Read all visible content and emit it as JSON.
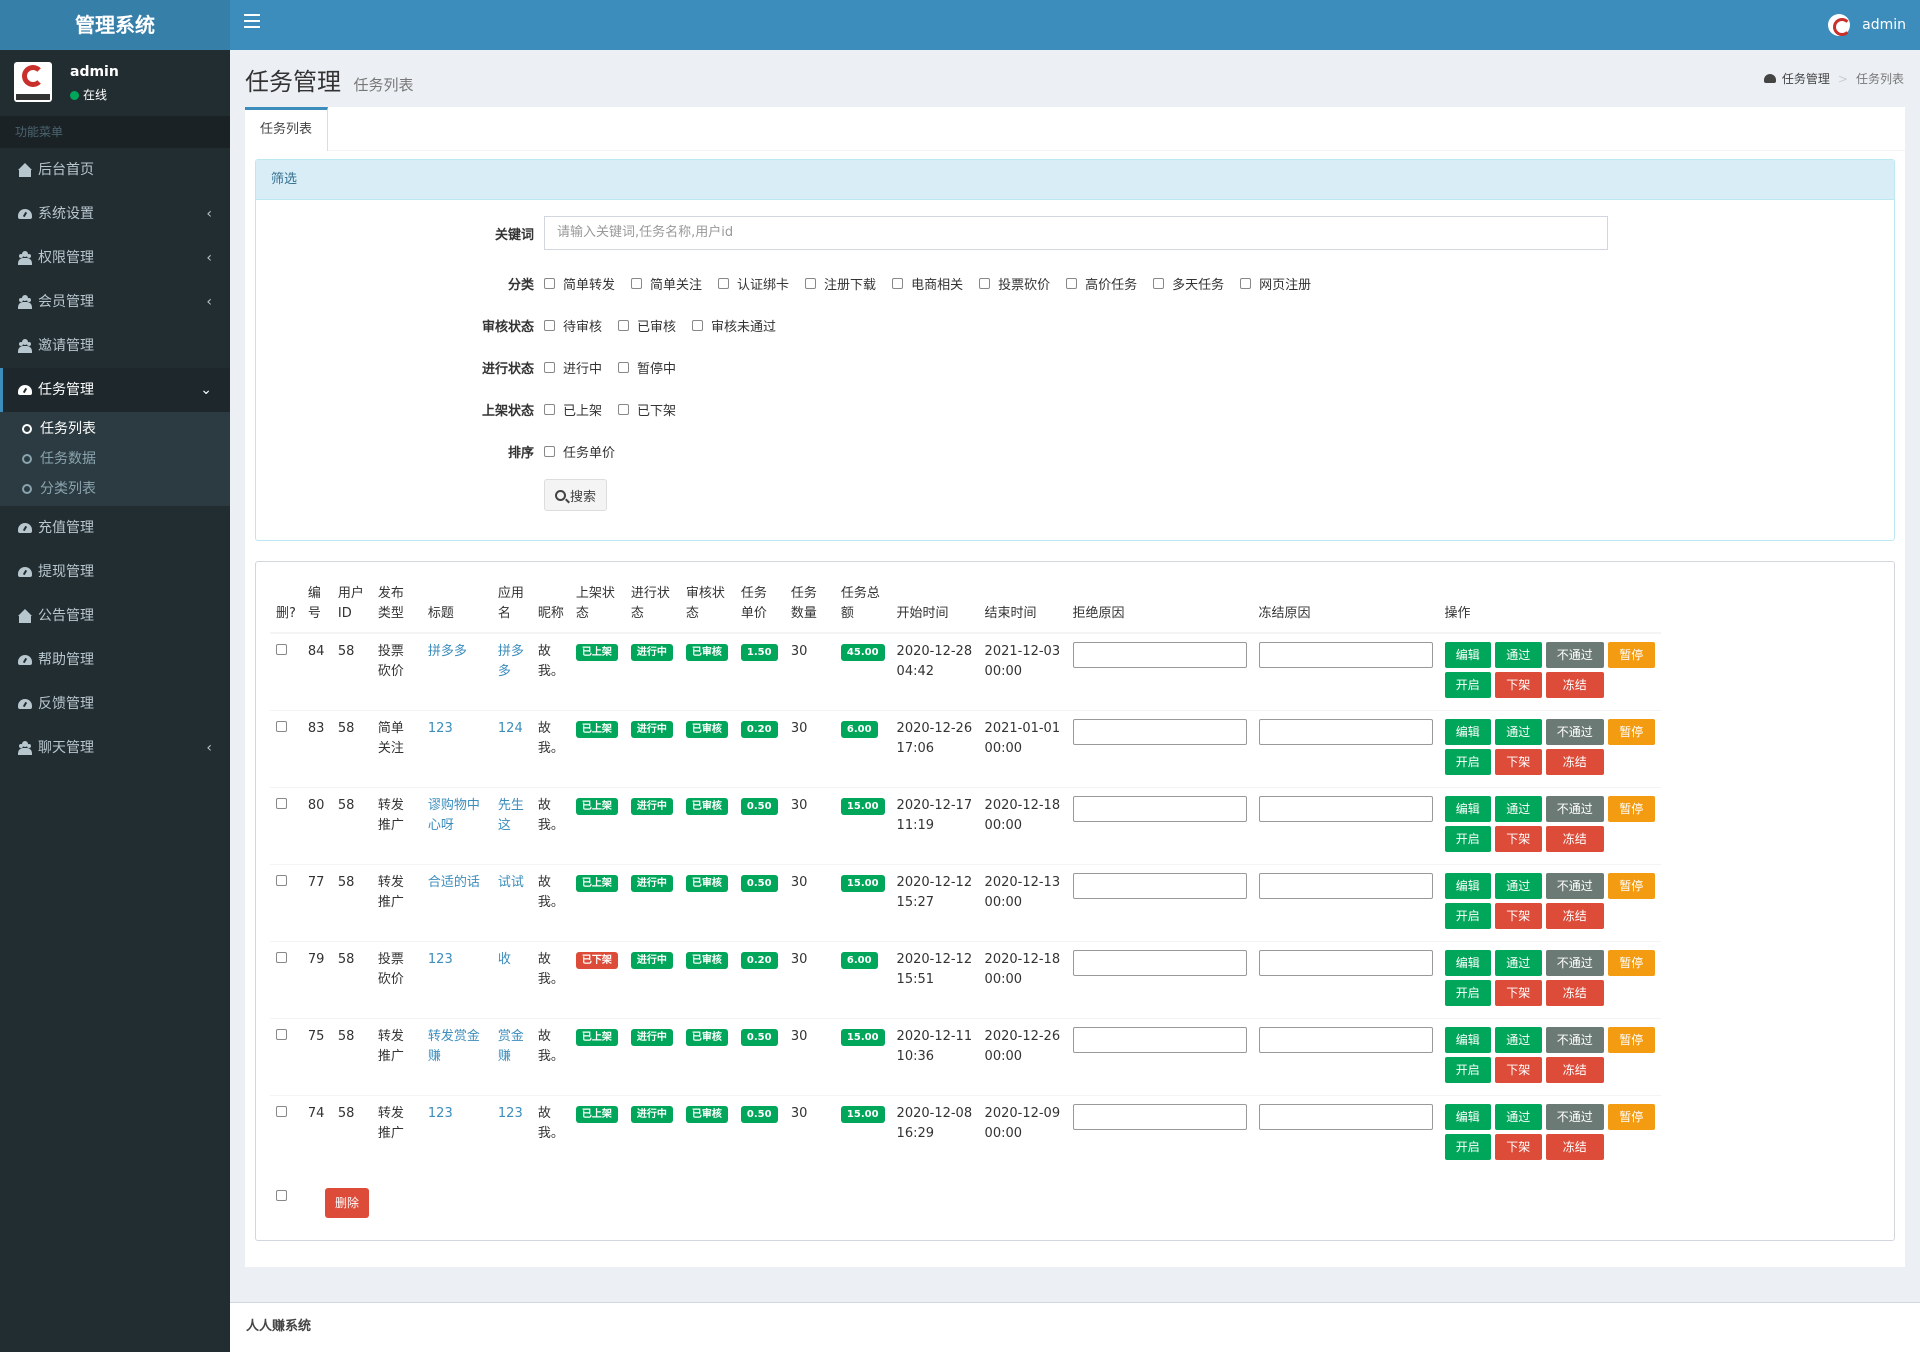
{
  "app": {
    "title": "管理系统",
    "user": "admin"
  },
  "sidebar": {
    "user": {
      "name": "admin",
      "status": "在线"
    },
    "menu_header": "功能菜单",
    "items_top": [
      {
        "label": "后台首页",
        "icon": "home-icon",
        "chevron": ""
      },
      {
        "label": "系统设置",
        "icon": "dashboard-icon",
        "chevron": "‹"
      },
      {
        "label": "权限管理",
        "icon": "users-icon",
        "chevron": "‹"
      },
      {
        "label": "会员管理",
        "icon": "users-icon",
        "chevron": "‹"
      },
      {
        "label": "邀请管理",
        "icon": "users-icon",
        "chevron": ""
      }
    ],
    "active_item": {
      "label": "任务管理",
      "icon": "dashboard-icon"
    },
    "sub_items": [
      "任务列表",
      "任务数据",
      "分类列表"
    ],
    "items_bottom": [
      {
        "label": "充值管理",
        "icon": "dashboard-icon",
        "chevron": ""
      },
      {
        "label": "提现管理",
        "icon": "dashboard-icon",
        "chevron": ""
      },
      {
        "label": "公告管理",
        "icon": "home-icon",
        "chevron": ""
      },
      {
        "label": "帮助管理",
        "icon": "dashboard-icon",
        "chevron": ""
      },
      {
        "label": "反馈管理",
        "icon": "dashboard-icon",
        "chevron": ""
      },
      {
        "label": "聊天管理",
        "icon": "users-icon",
        "chevron": "‹"
      }
    ]
  },
  "header": {
    "title": "任务管理",
    "subtitle": "任务列表"
  },
  "breadcrumb": {
    "home": "任务管理",
    "current": "任务列表"
  },
  "tab": "任务列表",
  "filter": {
    "title": "筛选",
    "keyword_label": "关键词",
    "keyword_placeholder": "请输入关键词,任务名称,用户id",
    "category_label": "分类",
    "categories": [
      "简单转发",
      "简单关注",
      "认证绑卡",
      "注册下载",
      "电商相关",
      "投票砍价",
      "高价任务",
      "多天任务",
      "网页注册"
    ],
    "audit_label": "审核状态",
    "audit_options": [
      "待审核",
      "已审核",
      "审核未通过"
    ],
    "progress_label": "进行状态",
    "progress_options": [
      "进行中",
      "暂停中"
    ],
    "shelf_label": "上架状态",
    "shelf_options": [
      "已上架",
      "已下架"
    ],
    "sort_label": "排序",
    "sort_options": [
      "任务单价"
    ],
    "search_button": "搜索"
  },
  "table": {
    "columns": [
      "删?",
      "编号",
      "用户ID",
      "发布类型",
      "标题",
      "应用名",
      "昵称",
      "上架状态",
      "进行状态",
      "审核状态",
      "任务单价",
      "任务数量",
      "任务总额",
      "开始时间",
      "结束时间",
      "拒绝原因",
      "冻结原因",
      "操作"
    ],
    "rows": [
      {
        "id": "84",
        "uid": "58",
        "type": "投票砍价",
        "title": "拼多多",
        "app": "拼多多",
        "nick": "故我。",
        "shelf": "已上架",
        "shelf_color": "#00a65a",
        "progress": "进行中",
        "audit": "已审核",
        "price": "1.50",
        "qty": "30",
        "total": "45.00",
        "start": "2020-12-28 04:42",
        "end": "2021-12-03 00:00"
      },
      {
        "id": "83",
        "uid": "58",
        "type": "简单关注",
        "title": "123",
        "app": "124",
        "nick": "故我。",
        "shelf": "已上架",
        "shelf_color": "#00a65a",
        "progress": "进行中",
        "audit": "已审核",
        "price": "0.20",
        "qty": "30",
        "total": "6.00",
        "start": "2020-12-26 17:06",
        "end": "2021-01-01 00:00"
      },
      {
        "id": "80",
        "uid": "58",
        "type": "转发推广",
        "title": "谬购物中心呀",
        "app": "先生这",
        "nick": "故我。",
        "shelf": "已上架",
        "shelf_color": "#00a65a",
        "progress": "进行中",
        "audit": "已审核",
        "price": "0.50",
        "qty": "30",
        "total": "15.00",
        "start": "2020-12-17 11:19",
        "end": "2020-12-18 00:00"
      },
      {
        "id": "77",
        "uid": "58",
        "type": "转发推广",
        "title": "合适的话",
        "app": "试试",
        "nick": "故我。",
        "shelf": "已上架",
        "shelf_color": "#00a65a",
        "progress": "进行中",
        "audit": "已审核",
        "price": "0.50",
        "qty": "30",
        "total": "15.00",
        "start": "2020-12-12 15:27",
        "end": "2020-12-13 00:00"
      },
      {
        "id": "79",
        "uid": "58",
        "type": "投票砍价",
        "title": "123",
        "app": "收",
        "nick": "故我。",
        "shelf": "已下架",
        "shelf_color": "#dd4b39",
        "progress": "进行中",
        "audit": "已审核",
        "price": "0.20",
        "qty": "30",
        "total": "6.00",
        "start": "2020-12-12 15:51",
        "end": "2020-12-18 00:00"
      },
      {
        "id": "75",
        "uid": "58",
        "type": "转发推广",
        "title": "转发赏金赚",
        "app": "赏金赚",
        "nick": "故我。",
        "shelf": "已上架",
        "shelf_color": "#00a65a",
        "progress": "进行中",
        "audit": "已审核",
        "price": "0.50",
        "qty": "30",
        "total": "15.00",
        "start": "2020-12-11 10:36",
        "end": "2020-12-26 00:00"
      },
      {
        "id": "74",
        "uid": "58",
        "type": "转发推广",
        "title": "123",
        "app": "123",
        "nick": "故我。",
        "shelf": "已上架",
        "shelf_color": "#00a65a",
        "progress": "进行中",
        "audit": "已审核",
        "price": "0.50",
        "qty": "30",
        "total": "15.00",
        "start": "2020-12-08 16:29",
        "end": "2020-12-09 00:00"
      }
    ],
    "actions": [
      "编辑",
      "通过",
      "不通过",
      "暂停",
      "开启",
      "下架",
      "冻结"
    ],
    "delete_button": "删除"
  },
  "footer": "人人赚系统"
}
